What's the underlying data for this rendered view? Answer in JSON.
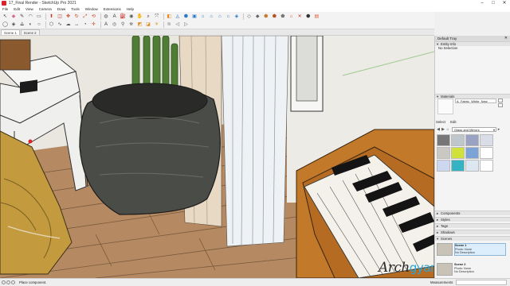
{
  "window": {
    "title": "17_Final Render - SketchUp Pro 2021"
  },
  "menu": [
    "File",
    "Edit",
    "View",
    "Camera",
    "Draw",
    "Tools",
    "Window",
    "Extensions",
    "Help"
  ],
  "toolbar": {
    "row1": [
      {
        "icon": "select-arrow-icon",
        "glyph": "↖",
        "color": "#333"
      },
      {
        "icon": "eraser-icon",
        "glyph": "◆",
        "color": "#d86a8f"
      },
      {
        "icon": "line-icon",
        "glyph": "✎",
        "color": "#333"
      },
      {
        "icon": "arc-icon",
        "glyph": "◠",
        "color": "#333"
      },
      {
        "icon": "rectangle-icon",
        "glyph": "▭",
        "color": "#333"
      },
      {
        "icon": "push-pull-icon",
        "glyph": "⬆",
        "color": "#c43a1e"
      },
      {
        "icon": "offset-icon",
        "glyph": "◫",
        "color": "#c43a1e"
      },
      {
        "icon": "move-icon",
        "glyph": "✥",
        "color": "#c43a1e"
      },
      {
        "icon": "rotate-icon",
        "glyph": "↻",
        "color": "#c43a1e"
      },
      {
        "icon": "scale-icon",
        "glyph": "⤢",
        "color": "#c43a1e"
      },
      {
        "icon": "follow-me-icon",
        "glyph": "⟲",
        "color": "#c43a1e"
      },
      {
        "icon": "tape-measure-icon",
        "glyph": "◍",
        "color": "#555"
      },
      {
        "icon": "text-icon",
        "glyph": "A",
        "color": "#333"
      },
      {
        "icon": "paint-bucket-icon",
        "glyph": "⛽",
        "color": "#333"
      },
      {
        "icon": "orbit-icon",
        "glyph": "◉",
        "color": "#555"
      },
      {
        "icon": "pan-icon",
        "glyph": "✋",
        "color": "#555"
      },
      {
        "icon": "zoom-icon",
        "glyph": "⌕",
        "color": "#333"
      },
      {
        "icon": "zoom-extents-icon",
        "glyph": "⤧",
        "color": "#333"
      },
      {
        "icon": "section-plane-icon",
        "glyph": "◧",
        "color": "#e08a1e"
      },
      {
        "icon": "sandbox-icon",
        "glyph": "◬",
        "color": "#2b78c5"
      },
      {
        "icon": "iso-view-icon",
        "glyph": "⬢",
        "color": "#2b78c5"
      },
      {
        "icon": "top-view-icon",
        "glyph": "▣",
        "color": "#2b78c5"
      },
      {
        "icon": "front-view-icon",
        "glyph": "⌂",
        "color": "#2b78c5"
      },
      {
        "icon": "right-view-icon",
        "glyph": "⌂",
        "color": "#2b78c5"
      },
      {
        "icon": "back-view-icon",
        "glyph": "⌂",
        "color": "#2b78c5"
      },
      {
        "icon": "left-view-icon",
        "glyph": "⌂",
        "color": "#2b78c5"
      },
      {
        "icon": "xray-icon",
        "glyph": "◈",
        "color": "#2b78c5"
      },
      {
        "icon": "wireframe-icon",
        "glyph": "◇",
        "color": "#555"
      },
      {
        "icon": "hidden-line-icon",
        "glyph": "◆",
        "color": "#666"
      },
      {
        "icon": "shaded-icon",
        "glyph": "⬟",
        "color": "#c67a2e"
      },
      {
        "icon": "textured-icon",
        "glyph": "⬟",
        "color": "#b3541e"
      },
      {
        "icon": "monochrome-icon",
        "glyph": "⬟",
        "color": "#777"
      },
      {
        "icon": "warehouse-icon",
        "glyph": "⌂",
        "color": "#d04a2a"
      },
      {
        "icon": "extension-warehouse-icon",
        "glyph": "✕",
        "color": "#c0392b"
      },
      {
        "icon": "sketchup-logo-icon",
        "glyph": "⬣",
        "color": "#333"
      },
      {
        "icon": "layout-icon",
        "glyph": "▤",
        "color": "#e05a3a"
      }
    ],
    "row2": [
      {
        "icon": "outliner-icon",
        "glyph": "◯",
        "color": "#444"
      },
      {
        "icon": "make-component-icon",
        "glyph": "◈",
        "color": "#444"
      },
      {
        "icon": "intersect-icon",
        "glyph": "⟁",
        "color": "#444"
      },
      {
        "icon": "solid-tools-icon",
        "glyph": "◐",
        "color": "#444"
      },
      {
        "icon": "circle-icon",
        "glyph": "○",
        "color": "#333"
      },
      {
        "icon": "polygon-icon",
        "glyph": "⬡",
        "color": "#333"
      },
      {
        "icon": "freehand-icon",
        "glyph": "∿",
        "color": "#333"
      },
      {
        "icon": "cloud-icon",
        "glyph": "☁",
        "color": "#555"
      },
      {
        "icon": "dimension-icon",
        "glyph": "↔",
        "color": "#333"
      },
      {
        "icon": "protractor-icon",
        "glyph": "◔",
        "color": "#333"
      },
      {
        "icon": "axes-icon",
        "glyph": "✛",
        "color": "#c43a1e"
      },
      {
        "icon": "3d-text-icon",
        "glyph": "A",
        "color": "#333"
      },
      {
        "icon": "look-around-icon",
        "glyph": "◎",
        "color": "#555"
      },
      {
        "icon": "walk-icon",
        "glyph": "⚲",
        "color": "#555"
      },
      {
        "icon": "position-camera-icon",
        "glyph": "⛯",
        "color": "#555"
      },
      {
        "icon": "section-cut-icon",
        "glyph": "◩",
        "color": "#e08a1e"
      },
      {
        "icon": "section-fill-icon",
        "glyph": "◪",
        "color": "#e08a1e"
      },
      {
        "icon": "shadows-icon",
        "glyph": "☀",
        "color": "#d5a21e"
      },
      {
        "icon": "fog-icon",
        "glyph": "≋",
        "color": "#777"
      },
      {
        "icon": "previous-view-icon",
        "glyph": "◁",
        "color": "#555"
      },
      {
        "icon": "next-view-icon",
        "glyph": "▷",
        "color": "#555"
      }
    ]
  },
  "scene_tabs": [
    {
      "label": "Scene 1",
      "active": true
    },
    {
      "label": "Scene 2",
      "active": false
    }
  ],
  "tray": {
    "title": "Default Tray",
    "entity_info": {
      "title": "Entity Info",
      "value": "No Selection"
    },
    "materials": {
      "title": "Materials",
      "current_name": "A_Fabric_White_New",
      "tab_select": "Select",
      "tab_edit": "Edit",
      "library": "Glass and Mirrors",
      "swatch_colors": [
        "#777777",
        "#bfc7cc",
        "#9aa3c4",
        "#d9dde8",
        "#c9c8c2",
        "#cfe13a",
        "#7ba3d6",
        "#ffffff",
        "#cdd8f0",
        "#35b3c4",
        "#dce7f2",
        "#ffffff"
      ]
    },
    "collapsed_panels": [
      "Components",
      "Styles",
      "Tags",
      "Shadows",
      "Scenes"
    ],
    "scenes": [
      {
        "name": "Scene 1",
        "photo_label": "Photo:",
        "photo_value": "None",
        "description": "No Description",
        "selected": true
      },
      {
        "name": "Scene 2",
        "photo_label": "Photo:",
        "photo_value": "None",
        "description": "No Description",
        "selected": false
      }
    ]
  },
  "status": {
    "text": "Place component.",
    "measurements_label": "Measurements"
  },
  "watermark": {
    "part1": "Arch",
    "part2": "gyan"
  }
}
